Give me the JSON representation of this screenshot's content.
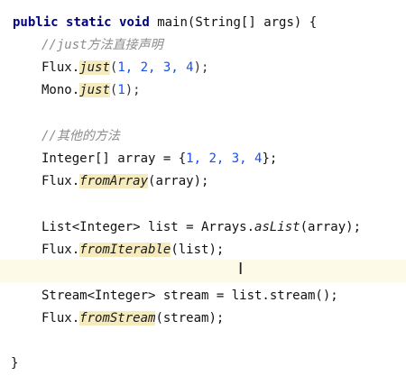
{
  "code": {
    "sig_public": "public",
    "sig_static": "static",
    "sig_void": "void",
    "sig_rest": "main(String[] args) {",
    "comment_just": "//just方法直接声明",
    "flux_prefix": "Flux.",
    "just_method": "just",
    "just_args_open": "(",
    "just_args_nums": "1, 2, 3, 4",
    "just_args_close": ");",
    "mono_prefix": "Mono.",
    "mono_method": "just",
    "mono_args_open": "(",
    "mono_args_num": "1",
    "mono_args_close": ");",
    "comment_other": "//其他的方法",
    "array_decl_prefix": "Integer[] array = {",
    "array_decl_nums": "1, 2, 3, 4",
    "array_decl_suffix": "};",
    "fromarray_prefix": "Flux.",
    "fromarray_method": "fromArray",
    "fromarray_args": "(array);",
    "list_decl_prefix": "List<Integer> list = Arrays.",
    "list_decl_method": "asList",
    "list_decl_args": "(array);",
    "fromiterable_prefix": "Flux.",
    "fromiterable_method": "fromIterable",
    "fromiterable_args": "(list);",
    "stream_decl": "Stream<Integer> stream = list.stream();",
    "fromstream_prefix": "Flux.",
    "fromstream_method": "fromStream",
    "fromstream_args": "(stream);",
    "closing_brace": "}"
  },
  "cursor": {
    "glyph": "I"
  }
}
